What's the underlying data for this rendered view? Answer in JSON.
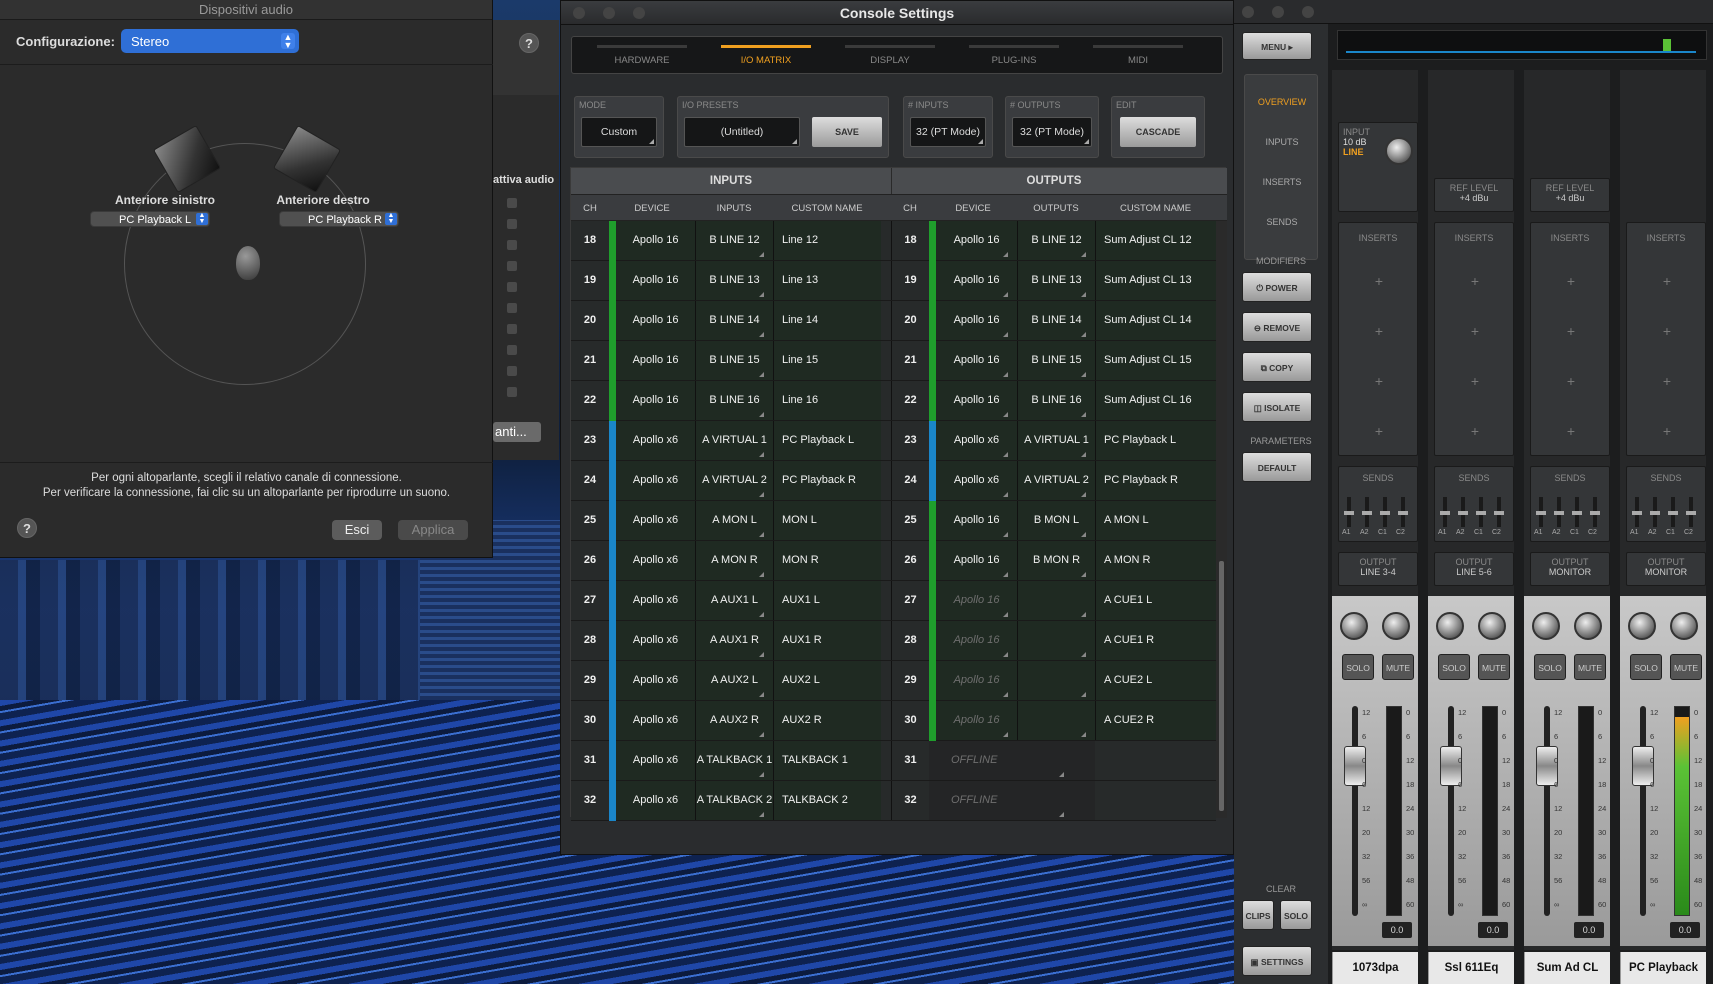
{
  "audio_devices": {
    "title": "Dispositivi audio",
    "config_label": "Configurazione:",
    "config_value": "Stereo",
    "help": "?",
    "front_left_label": "Anteriore sinistro",
    "front_right_label": "Anteriore destro",
    "left_channel": "PC Playback L",
    "right_channel": "PC Playback R",
    "note_line1": "Per ogni altoparlante, scegli il relativo canale di connessione.",
    "note_line2": "Per verificare la connessione, fai clic su un altoparlante per riprodurre un suono.",
    "exit_button": "Esci",
    "apply_button": "Applica",
    "behind_label": "attiva audio",
    "behind_button": "anti..."
  },
  "console": {
    "title": "Console Settings",
    "tabs": [
      "HARDWARE",
      "I/O MATRIX",
      "DISPLAY",
      "PLUG-INS",
      "MIDI"
    ],
    "active_tab": "I/O MATRIX",
    "mode_caption": "MODE",
    "mode_value": "Custom",
    "presets_caption": "I/O PRESETS",
    "presets_value": "(Untitled)",
    "save_button": "SAVE",
    "inputs_caption": "# INPUTS",
    "inputs_value": "32 (PT Mode)",
    "outputs_caption": "# OUTPUTS",
    "outputs_value": "32 (PT Mode)",
    "edit_caption": "EDIT",
    "cascade_button": "CASCADE",
    "inputs_header": "INPUTS",
    "outputs_header": "OUTPUTS",
    "col_headers": [
      "CH",
      "DEVICE",
      "INPUTS",
      "CUSTOM NAME",
      "CH",
      "DEVICE",
      "OUTPUTS",
      "CUSTOM NAME"
    ],
    "rows": [
      {
        "ch": "18",
        "in_dev": "Apollo 16",
        "in": "B LINE 12",
        "in_name": "Line 12",
        "in_color": "green",
        "out_dev": "Apollo 16",
        "out": "B LINE 12",
        "out_name": "Sum Adjust CL 12",
        "out_color": "green",
        "out_state": "on"
      },
      {
        "ch": "19",
        "in_dev": "Apollo 16",
        "in": "B LINE 13",
        "in_name": "Line 13",
        "in_color": "green",
        "out_dev": "Apollo 16",
        "out": "B LINE 13",
        "out_name": "Sum Adjust CL 13",
        "out_color": "green",
        "out_state": "on"
      },
      {
        "ch": "20",
        "in_dev": "Apollo 16",
        "in": "B LINE 14",
        "in_name": "Line 14",
        "in_color": "green",
        "out_dev": "Apollo 16",
        "out": "B LINE 14",
        "out_name": "Sum Adjust CL 14",
        "out_color": "green",
        "out_state": "on"
      },
      {
        "ch": "21",
        "in_dev": "Apollo 16",
        "in": "B LINE 15",
        "in_name": "Line 15",
        "in_color": "green",
        "out_dev": "Apollo 16",
        "out": "B LINE 15",
        "out_name": "Sum Adjust CL 15",
        "out_color": "green",
        "out_state": "on"
      },
      {
        "ch": "22",
        "in_dev": "Apollo 16",
        "in": "B LINE 16",
        "in_name": "Line 16",
        "in_color": "green",
        "out_dev": "Apollo 16",
        "out": "B LINE 16",
        "out_name": "Sum Adjust CL 16",
        "out_color": "green",
        "out_state": "on"
      },
      {
        "ch": "23",
        "in_dev": "Apollo x6",
        "in": "A VIRTUAL 1",
        "in_name": "PC Playback L",
        "in_color": "blue",
        "out_dev": "Apollo x6",
        "out": "A VIRTUAL 1",
        "out_name": "PC Playback L",
        "out_color": "blue",
        "out_state": "on"
      },
      {
        "ch": "24",
        "in_dev": "Apollo x6",
        "in": "A VIRTUAL 2",
        "in_name": "PC Playback R",
        "in_color": "blue",
        "out_dev": "Apollo x6",
        "out": "A VIRTUAL 2",
        "out_name": "PC Playback R",
        "out_color": "blue",
        "out_state": "on"
      },
      {
        "ch": "25",
        "in_dev": "Apollo x6",
        "in": "A MON L",
        "in_name": "MON L",
        "in_color": "blue",
        "out_dev": "Apollo 16",
        "out": "B MON L",
        "out_name": "A MON L",
        "out_color": "green",
        "out_state": "on"
      },
      {
        "ch": "26",
        "in_dev": "Apollo x6",
        "in": "A MON R",
        "in_name": "MON R",
        "in_color": "blue",
        "out_dev": "Apollo 16",
        "out": "B MON R",
        "out_name": "A MON R",
        "out_color": "green",
        "out_state": "on"
      },
      {
        "ch": "27",
        "in_dev": "Apollo x6",
        "in": "A AUX1 L",
        "in_name": "AUX1 L",
        "in_color": "blue",
        "out_dev": "Apollo 16",
        "out": "",
        "out_name": "A CUE1 L",
        "out_color": "green",
        "out_state": "dim"
      },
      {
        "ch": "28",
        "in_dev": "Apollo x6",
        "in": "A AUX1 R",
        "in_name": "AUX1 R",
        "in_color": "blue",
        "out_dev": "Apollo 16",
        "out": "",
        "out_name": "A CUE1 R",
        "out_color": "green",
        "out_state": "dim"
      },
      {
        "ch": "29",
        "in_dev": "Apollo x6",
        "in": "A AUX2 L",
        "in_name": "AUX2 L",
        "in_color": "blue",
        "out_dev": "Apollo 16",
        "out": "",
        "out_name": "A CUE2 L",
        "out_color": "green",
        "out_state": "dim"
      },
      {
        "ch": "30",
        "in_dev": "Apollo x6",
        "in": "A AUX2 R",
        "in_name": "AUX2 R",
        "in_color": "blue",
        "out_dev": "Apollo 16",
        "out": "",
        "out_name": "A CUE2 R",
        "out_color": "green",
        "out_state": "dim"
      },
      {
        "ch": "31",
        "in_dev": "Apollo x6",
        "in": "A TALKBACK 1",
        "in_name": "TALKBACK 1",
        "in_color": "blue",
        "out_dev": "OFFLINE",
        "out": "",
        "out_name": "",
        "out_color": "none",
        "out_state": "offline"
      },
      {
        "ch": "32",
        "in_dev": "Apollo x6",
        "in": "A TALKBACK 2",
        "in_name": "TALKBACK 2",
        "in_color": "blue",
        "out_dev": "OFFLINE",
        "out": "",
        "out_name": "",
        "out_color": "none",
        "out_state": "offline"
      }
    ]
  },
  "mixer": {
    "menu_button": "MENU",
    "nav": [
      "OVERVIEW",
      "INPUTS",
      "INSERTS",
      "SENDS"
    ],
    "modifiers_label": "MODIFIERS",
    "modifiers": [
      "POWER",
      "REMOVE",
      "COPY",
      "ISOLATE"
    ],
    "parameters_label": "PARAMETERS",
    "default_button": "DEFAULT",
    "clear_label": "CLEAR",
    "clips_button": "CLIPS",
    "solo_clear_button": "SOLO",
    "settings_button": "SETTINGS",
    "input_caption": "INPUT",
    "input_gain": "10 dB",
    "input_type": "LINE",
    "inserts_label": "INSERTS",
    "sends_label": "SENDS",
    "send_labels": [
      "A1",
      "A2",
      "C1",
      "C2"
    ],
    "solo_label": "SOLO",
    "mute_label": "MUTE",
    "scale": [
      "12",
      "6",
      "0",
      "6",
      "12",
      "20",
      "32",
      "56",
      "∞"
    ],
    "meter_scale": [
      "0",
      "6",
      "12",
      "18",
      "24",
      "30",
      "36",
      "48",
      "60"
    ],
    "channels": [
      {
        "name": "1073dpa",
        "ref_caption": "",
        "ref_level": "",
        "output_caption": "OUTPUT",
        "output": "LINE 3-4",
        "value": "0.0",
        "meter": 0.0
      },
      {
        "name": "Ssl 611Eq",
        "ref_caption": "REF LEVEL",
        "ref_level": "+4 dBu",
        "output_caption": "OUTPUT",
        "output": "LINE 5-6",
        "value": "0.0",
        "meter": 0.0
      },
      {
        "name": "Sum Ad CL",
        "ref_caption": "REF LEVEL",
        "ref_level": "+4 dBu",
        "output_caption": "OUTPUT",
        "output": "MONITOR",
        "value": "0.0",
        "meter": 0.0
      },
      {
        "name": "PC Playback",
        "ref_caption": "",
        "ref_level": "",
        "output_caption": "OUTPUT",
        "output": "MONITOR",
        "value": "0.0",
        "meter": 0.95
      }
    ]
  },
  "colors": {
    "green": "#1f9e2c",
    "blue": "#1a86c9",
    "accent": "#f0a020"
  }
}
